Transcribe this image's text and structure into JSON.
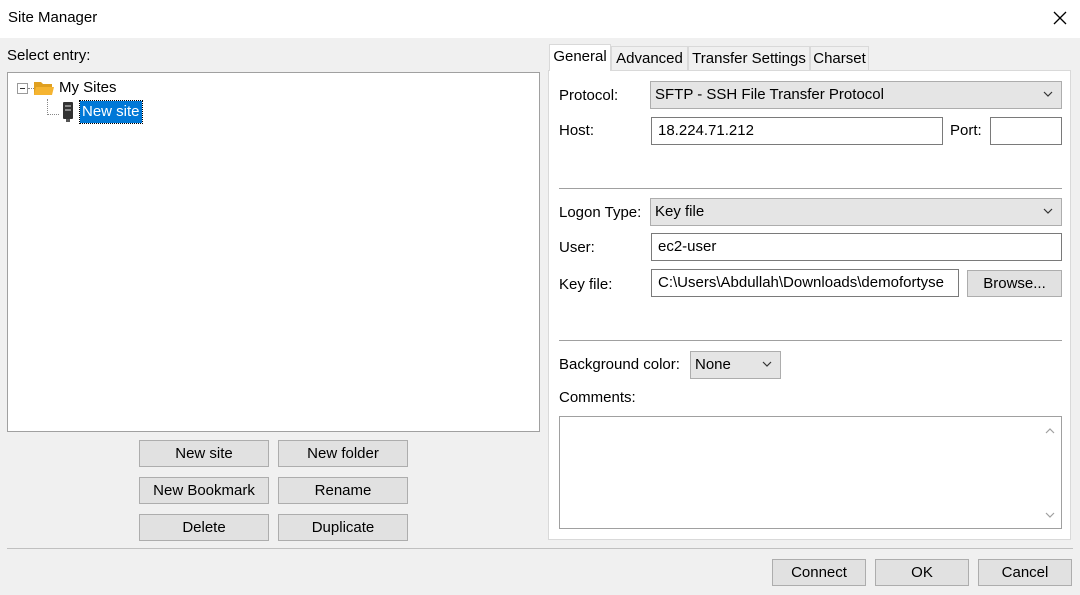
{
  "window": {
    "title": "Site Manager"
  },
  "left": {
    "select_label": "Select entry:",
    "tree": {
      "root": "My Sites",
      "child": "New site"
    },
    "buttons": {
      "new_site": "New site",
      "new_folder": "New folder",
      "new_bookmark": "New Bookmark",
      "rename": "Rename",
      "delete": "Delete",
      "duplicate": "Duplicate"
    }
  },
  "tabs": [
    "General",
    "Advanced",
    "Transfer Settings",
    "Charset"
  ],
  "general": {
    "protocol_label": "Protocol:",
    "protocol_value": "SFTP - SSH File Transfer Protocol",
    "host_label": "Host:",
    "host_value": "18.224.71.212",
    "port_label": "Port:",
    "port_value": "",
    "logon_label": "Logon Type:",
    "logon_value": "Key file",
    "user_label": "User:",
    "user_value": "ec2-user",
    "keyfile_label": "Key file:",
    "keyfile_value": "C:\\Users\\Abdullah\\Downloads\\demofortyse",
    "browse_label": "Browse...",
    "bgcolor_label": "Background color:",
    "bgcolor_value": "None",
    "comments_label": "Comments:"
  },
  "footer": {
    "connect": "Connect",
    "ok": "OK",
    "cancel": "Cancel"
  },
  "colors": {
    "selection": "#0078d7",
    "folder": "#f5b431"
  }
}
